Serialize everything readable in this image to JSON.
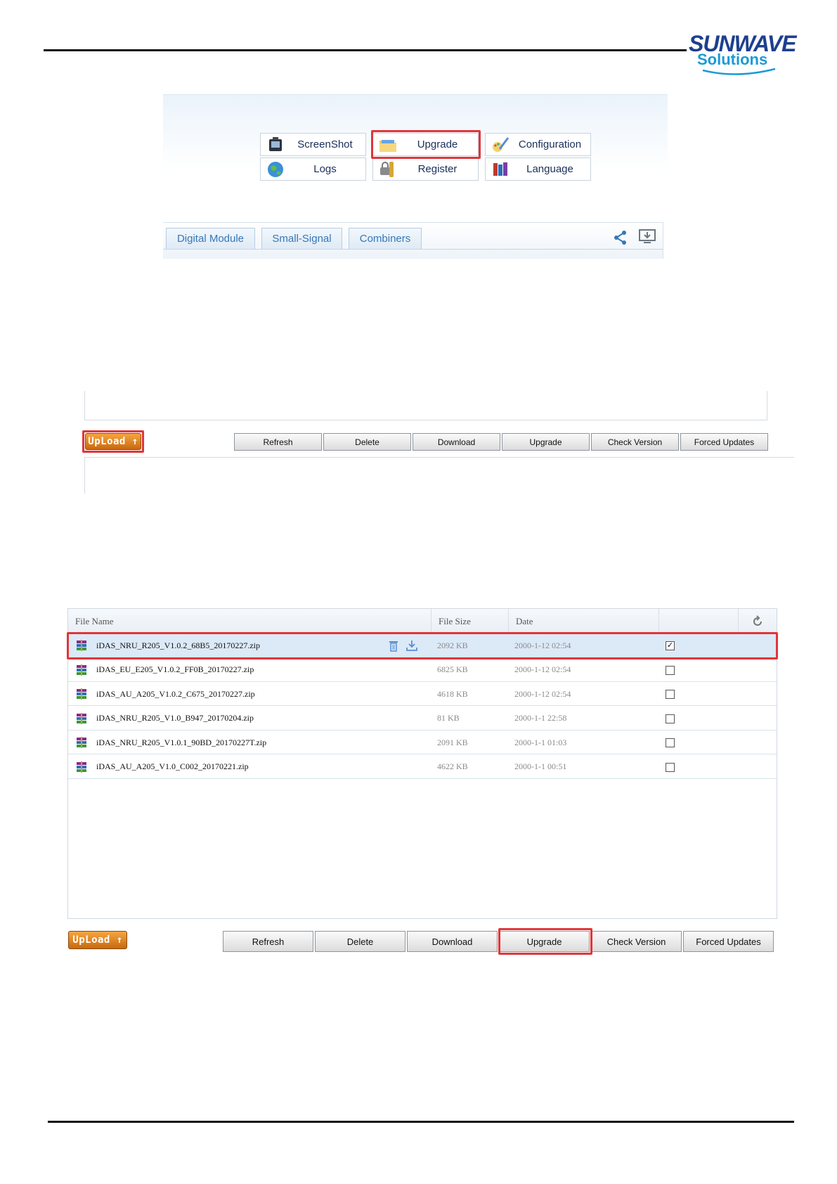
{
  "logo": {
    "line1": "SUNWAVE",
    "line2": "Solutions"
  },
  "menu": {
    "buttons": [
      {
        "label": "ScreenShot",
        "icon": "camera-icon"
      },
      {
        "label": "Upgrade",
        "icon": "folder-icon",
        "highlighted": true
      },
      {
        "label": "Configuration",
        "icon": "paint-brush-icon"
      },
      {
        "label": "Logs",
        "icon": "globe-icon"
      },
      {
        "label": "Register",
        "icon": "lock-icon"
      },
      {
        "label": "Language",
        "icon": "books-icon"
      }
    ],
    "highlight_color": "#e0363a"
  },
  "tabs": [
    "Digital Module",
    "Small-Signal",
    "Combiners"
  ],
  "upload_label": "UpLoad ↑",
  "toolbar": [
    "Refresh",
    "Delete",
    "Download",
    "Upgrade",
    "Check Version",
    "Forced Updates"
  ],
  "file_table": {
    "columns": [
      "File Name",
      "File Size",
      "Date"
    ],
    "rows": [
      {
        "name": "iDAS_NRU_R205_V1.0.2_68B5_20170227.zip",
        "size": "2092 KB",
        "date": "2000-1-12 02:54",
        "checked": true
      },
      {
        "name": "iDAS_EU_E205_V1.0.2_FF0B_20170227.zip",
        "size": "6825 KB",
        "date": "2000-1-12 02:54",
        "checked": false
      },
      {
        "name": "iDAS_AU_A205_V1.0.2_C675_20170227.zip",
        "size": "4618 KB",
        "date": "2000-1-12 02:54",
        "checked": false
      },
      {
        "name": "iDAS_NRU_R205_V1.0_B947_20170204.zip",
        "size": "81 KB",
        "date": "2000-1-1 22:58",
        "checked": false
      },
      {
        "name": "iDAS_NRU_R205_V1.0.1_90BD_20170227T.zip",
        "size": "2091 KB",
        "date": "2000-1-1 01:03",
        "checked": false
      },
      {
        "name": "iDAS_AU_A205_V1.0_C002_20170221.zip",
        "size": "4622 KB",
        "date": "2000-1-1 00:51",
        "checked": false
      }
    ]
  }
}
